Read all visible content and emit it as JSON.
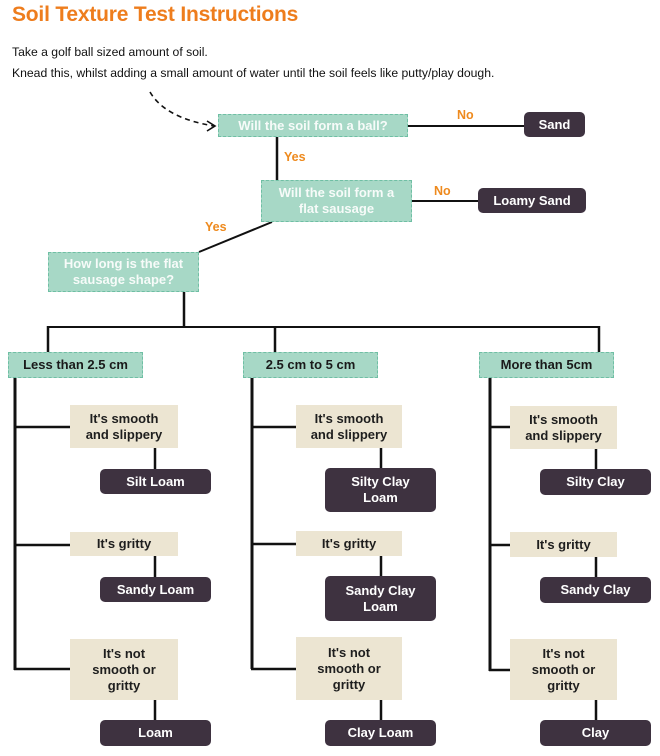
{
  "title": "Soil Texture Test Instructions",
  "intro": [
    "Take a golf ball sized amount of soil.",
    "Knead this, whilst adding a small amount of water until the soil feels like putty/play dough."
  ],
  "colors": {
    "title": "#ee7d1d",
    "branch_label": "#ee8a1e",
    "question_fill": "#a7d8c6",
    "feel_fill": "#ece5d2",
    "result_fill": "#3e3240"
  },
  "questions": {
    "q1": "Will the soil form a ball?",
    "q2": "Will the soil form a flat sausage",
    "q3": "How long is the flat sausage shape?"
  },
  "branch_labels": {
    "q1_no": "No",
    "q1_yes": "Yes",
    "q2_no": "No",
    "q2_yes": "Yes"
  },
  "early_results": {
    "q1_no": "Sand",
    "q2_no": "Loamy Sand"
  },
  "columns": [
    {
      "range": "Less than 2.5 cm",
      "feels": [
        {
          "feel": "It's smooth and slippery",
          "result": "Silt Loam"
        },
        {
          "feel": "It's gritty",
          "result": "Sandy Loam"
        },
        {
          "feel": "It's not smooth or gritty",
          "result": "Loam"
        }
      ]
    },
    {
      "range": "2.5 cm to 5 cm",
      "feels": [
        {
          "feel": "It's smooth and slippery",
          "result": "Silty Clay Loam"
        },
        {
          "feel": "It's gritty",
          "result": "Sandy Clay Loam"
        },
        {
          "feel": "It's not smooth or gritty",
          "result": "Clay Loam"
        }
      ]
    },
    {
      "range": "More than 5cm",
      "feels": [
        {
          "feel": "It's smooth and slippery",
          "result": "Silty Clay"
        },
        {
          "feel": "It's gritty",
          "result": "Sandy Clay"
        },
        {
          "feel": "It's not smooth or gritty",
          "result": "Clay"
        }
      ]
    }
  ]
}
